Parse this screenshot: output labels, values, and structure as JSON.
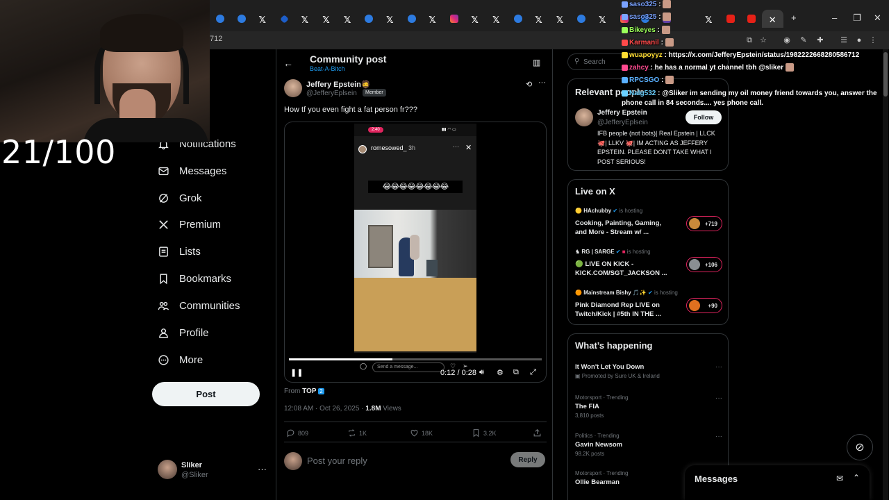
{
  "browser": {
    "tabs": [
      {
        "icon": "blue"
      },
      {
        "icon": "blue"
      },
      {
        "icon": "x"
      },
      {
        "icon": "diam"
      },
      {
        "icon": "x"
      },
      {
        "icon": "x"
      },
      {
        "icon": "x"
      },
      {
        "icon": "blue"
      },
      {
        "icon": "x"
      },
      {
        "icon": "blue"
      },
      {
        "icon": "x"
      },
      {
        "icon": "insta"
      },
      {
        "icon": "x"
      },
      {
        "icon": "x"
      },
      {
        "icon": "blue"
      },
      {
        "icon": "x"
      },
      {
        "icon": "x"
      },
      {
        "icon": "blue"
      },
      {
        "icon": "x"
      },
      {
        "icon": "insta"
      },
      {
        "icon": "blue"
      },
      {
        "icon": "purple"
      },
      {
        "icon": "dark"
      },
      {
        "icon": "x"
      },
      {
        "icon": "red"
      },
      {
        "icon": "red"
      },
      {
        "icon": "close",
        "active": true
      }
    ],
    "new_tab": "+",
    "minimize": "–",
    "restore": "❐",
    "close": "✕",
    "url_fragment": "712"
  },
  "stream_overlay": {
    "counter": "21/100"
  },
  "chat": [
    {
      "user": "saso325",
      "color": "#7aa2ff",
      "text": ":",
      "emote": true
    },
    {
      "user": "saso325",
      "color": "#7aa2ff",
      "text": ":",
      "emote": true
    },
    {
      "user": "Bikeyes",
      "color": "#9bff5a",
      "text": ":",
      "emote": true
    },
    {
      "user": "Karmanil",
      "color": "#ff4a4a",
      "text": ":",
      "emote": true
    },
    {
      "user": "wuapoyyz",
      "color": "#ffdd33",
      "text": ": https://x.com/JefferyEpstein/status/1982222668280586712"
    },
    {
      "user": "zahcy",
      "color": "#ff4a8f",
      "text": ": he has a normal yt channel tbh @sliker",
      "emote": true
    },
    {
      "user": "RPCSGO",
      "color": "#5ab0ff",
      "text": ":",
      "emote": true
    },
    {
      "user": "Nalg532",
      "color": "#6ad0ff",
      "text": ": @Sliker im sending my oil money friend towards you, answer the phone call in 84 seconds.... yes phone call."
    }
  ],
  "nav": {
    "items": [
      {
        "label": "Notifications",
        "icon": "bell-icon"
      },
      {
        "label": "Messages",
        "icon": "mail-icon"
      },
      {
        "label": "Grok",
        "icon": "grok-icon"
      },
      {
        "label": "Premium",
        "icon": "x-logo-icon"
      },
      {
        "label": "Lists",
        "icon": "list-icon"
      },
      {
        "label": "Bookmarks",
        "icon": "bookmark-icon"
      },
      {
        "label": "Communities",
        "icon": "people-icon"
      },
      {
        "label": "Profile",
        "icon": "person-icon"
      },
      {
        "label": "More",
        "icon": "more-circle-icon"
      }
    ],
    "partial_label": "e",
    "post_button": "Post",
    "account": {
      "name": "Sliker",
      "handle": "@Sliker",
      "more": "···"
    }
  },
  "main": {
    "title": "Community post",
    "subtitle": "Beat-A-Bitch",
    "post": {
      "author_name": "Jeffery Epstein",
      "author_badge": "🧔",
      "author_handle": "@JefferyEplsein",
      "member_badge": "Member",
      "text": "How tf you even fight a fat person fr???",
      "video": {
        "phone_time": "2:40",
        "story_user": "romesowed_",
        "story_age": "3h",
        "emoji_strip": "😂😂😂😂😂😂😂😂",
        "message_placeholder": "Send a message...",
        "elapsed": "0:12",
        "duration": "0:28",
        "progress": 0.41
      },
      "from_prefix": "From",
      "from_source": "TOP",
      "from_number": "2",
      "timestamp": "12:08 AM · Oct 26, 2025 · ",
      "views_count": "1.8M",
      "views_label": " Views",
      "stats": {
        "replies": "809",
        "reposts": "1K",
        "likes": "18K",
        "bookmarks": "3.2K"
      }
    },
    "reply": {
      "placeholder": "Post your reply",
      "button": "Reply"
    }
  },
  "sidebar": {
    "search_placeholder": "Search",
    "relevant": {
      "title": "Relevant people",
      "name": "Jeffery Epstein",
      "handle": "@JefferyEplsein",
      "follow": "Follow",
      "bio": "IFB people (not bots)| Real Epstein | LLCK 🐙| LLKV 🐙| IM ACTING AS JEFFERY EPSTEIN. PLEASE DONT TAKE WHAT I POST SERIOUS!"
    },
    "live": {
      "title": "Live on X",
      "items": [
        {
          "host": "HAchubby",
          "status": "is hosting",
          "title": "Cooking, Painting, Gaming, and More - Stream w/ ...",
          "count": "+719"
        },
        {
          "host": "RG | SARGE",
          "status": "is hosting",
          "title": "🟢 LIVE ON KICK - KICK.COM/SGT_JACKSON ...",
          "count": "+106"
        },
        {
          "host": "Mainstream Bishy 🎵✨",
          "status": "is hosting",
          "title": "Pink Diamond Rep LIVE on Twitch/Kick | #5th IN THE ...",
          "count": "+90"
        }
      ]
    },
    "happening": {
      "title": "What’s happening",
      "items": [
        {
          "category": "",
          "name": "It Won't Let You Down",
          "count": "Promoted by Sure UK & Ireland"
        },
        {
          "category": "Motorsport · Trending",
          "name": "The FIA",
          "count": "3,810 posts"
        },
        {
          "category": "Politics · Trending",
          "name": "Gavin Newsom",
          "count": "98.2K posts"
        },
        {
          "category": "Motorsport · Trending",
          "name": "Ollie Bearman",
          "count": ""
        }
      ]
    }
  },
  "messages_drawer": {
    "title": "Messages"
  }
}
